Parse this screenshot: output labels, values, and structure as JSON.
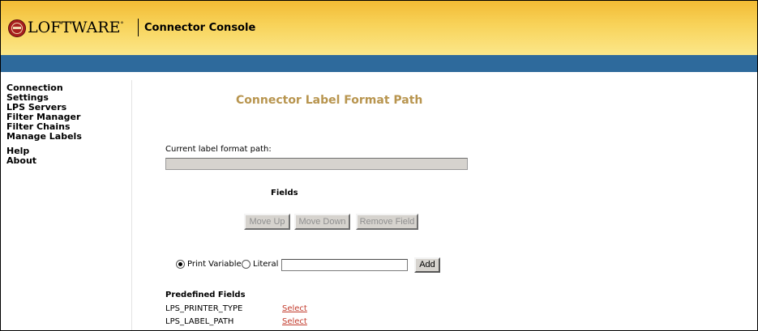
{
  "header": {
    "brand": "LOFTWARE",
    "trademark": "°",
    "app_title": "Connector Console"
  },
  "sidebar": {
    "items": [
      {
        "label": "Connection"
      },
      {
        "label": "Settings"
      },
      {
        "label": "LPS Servers"
      },
      {
        "label": "Filter Manager"
      },
      {
        "label": "Filter Chains"
      },
      {
        "label": "Manage Labels"
      },
      {
        "label": "Help"
      },
      {
        "label": "About"
      }
    ]
  },
  "main": {
    "title": "Connector Label Format Path",
    "path_label": "Current label format path:",
    "path_value": "",
    "fields_heading": "Fields",
    "buttons": {
      "move_up": "Move Up",
      "move_down": "Move Down",
      "remove_field": "Remove Field",
      "add": "Add"
    },
    "radio": {
      "print_variable": "Print Variable",
      "literal": "Literal",
      "selected": "print_variable"
    },
    "literal_input_value": "",
    "predefined": {
      "heading": "Predefined Fields",
      "rows": [
        {
          "name": "LPS_PRINTER_TYPE",
          "action": "Select"
        },
        {
          "name": "LPS_LABEL_PATH",
          "action": "Select"
        }
      ]
    }
  },
  "colors": {
    "header_gold": "#f2bb34",
    "blue_bar": "#2e6a9c",
    "title_tan": "#b8954f",
    "link_red": "#c23a2b"
  }
}
